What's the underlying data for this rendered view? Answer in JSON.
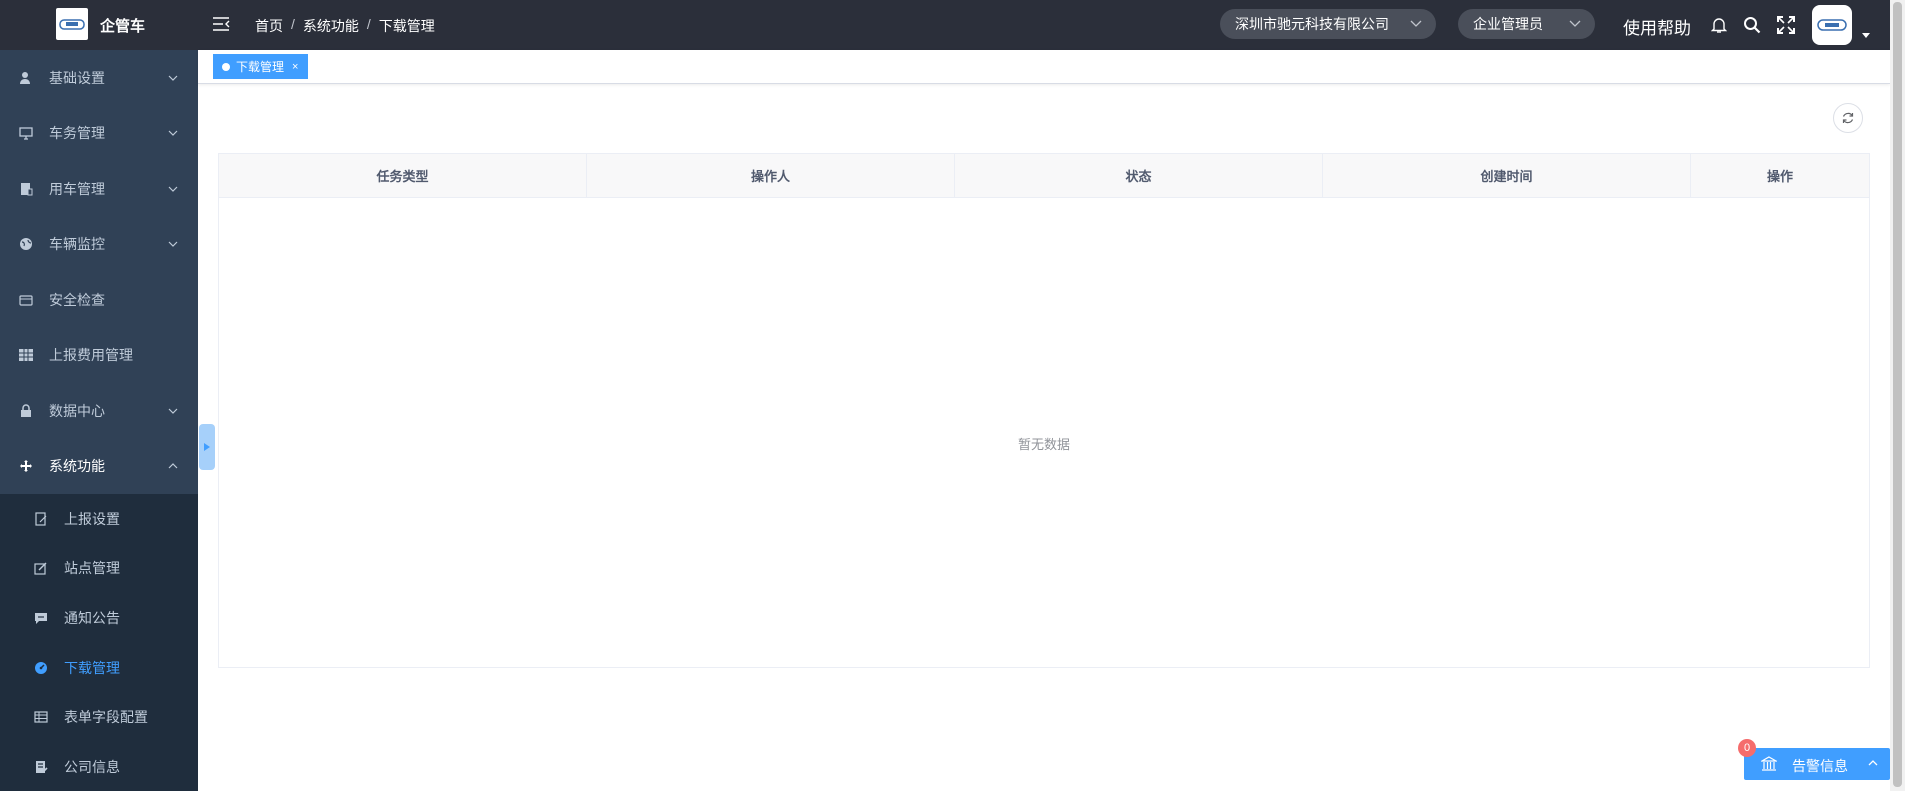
{
  "app": {
    "name": "企管车"
  },
  "header": {
    "breadcrumbs": [
      "首页",
      "系统功能",
      "下载管理"
    ],
    "separator": "/",
    "company_select": "深圳市驰元科技有限公司",
    "role_select": "企业管理员",
    "help_label": "使用帮助"
  },
  "sidebar": {
    "items": [
      {
        "label": "基础设置"
      },
      {
        "label": "车务管理"
      },
      {
        "label": "用车管理"
      },
      {
        "label": "车辆监控"
      },
      {
        "label": "安全检查"
      },
      {
        "label": "上报费用管理"
      },
      {
        "label": "数据中心"
      },
      {
        "label": "系统功能"
      }
    ],
    "subitems": [
      {
        "label": "上报设置"
      },
      {
        "label": "站点管理"
      },
      {
        "label": "通知公告"
      },
      {
        "label": "下载管理"
      },
      {
        "label": "表单字段配置"
      },
      {
        "label": "公司信息"
      }
    ]
  },
  "tags": {
    "active": "下载管理",
    "close": "×"
  },
  "table": {
    "columns": [
      "任务类型",
      "操作人",
      "状态",
      "创建时间",
      "操作"
    ],
    "empty_text": "暂无数据"
  },
  "alarm": {
    "label": "告警信息",
    "count": "0"
  },
  "colors": {
    "accent": "#409eff",
    "sidebar": "#304156",
    "header": "#2b2f3a"
  }
}
